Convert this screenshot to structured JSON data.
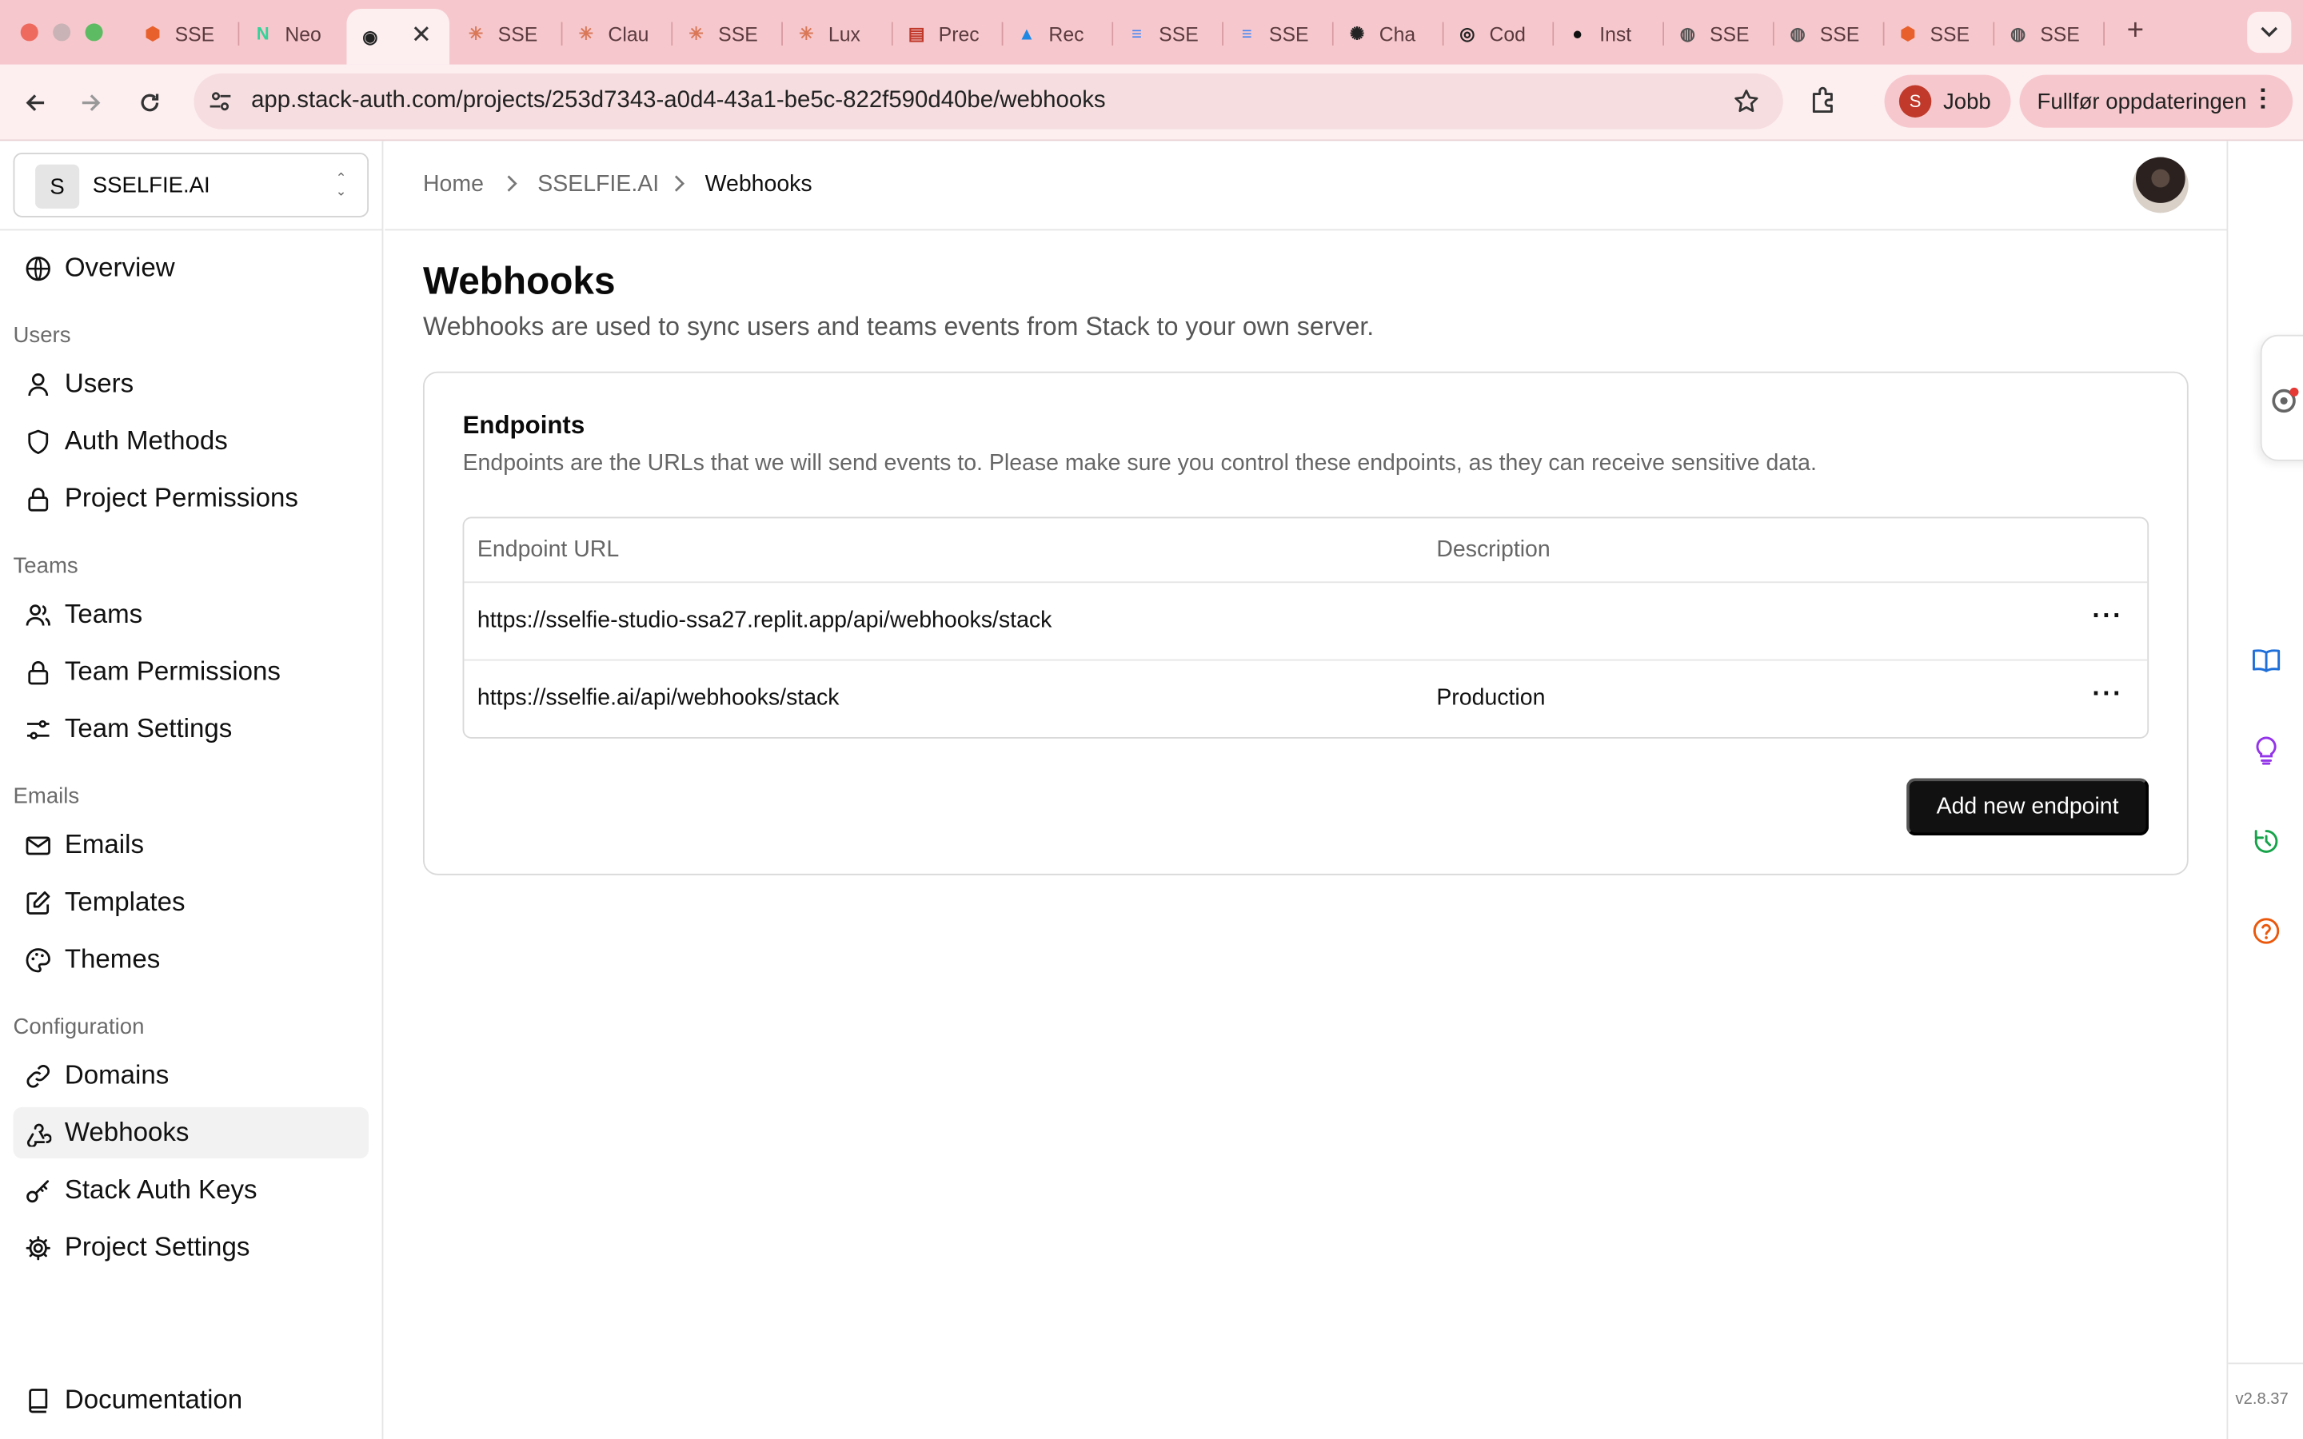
{
  "browser": {
    "tabs": [
      {
        "title": "SSE",
        "icon": "stack-icon",
        "color": "#e8612c"
      },
      {
        "title": "Neo",
        "icon": "neon-icon",
        "color": "#34d399"
      },
      {
        "title": "",
        "icon": "stack-auth-icon",
        "color": "#222222",
        "active": true
      },
      {
        "title": "SSE",
        "icon": "claude-icon",
        "color": "#d97757"
      },
      {
        "title": "Clau",
        "icon": "claude-icon",
        "color": "#d97757"
      },
      {
        "title": "SSE",
        "icon": "claude-icon",
        "color": "#d97757"
      },
      {
        "title": "Lux",
        "icon": "claude-icon",
        "color": "#d97757"
      },
      {
        "title": "Prec",
        "icon": "doc-red-icon",
        "color": "#c0392b"
      },
      {
        "title": "Rec",
        "icon": "drive-icon",
        "color": "#1e88e5"
      },
      {
        "title": "SSE",
        "icon": "docs-icon",
        "color": "#4285f4"
      },
      {
        "title": "SSE",
        "icon": "docs-icon",
        "color": "#4285f4"
      },
      {
        "title": "Cha",
        "icon": "openai-icon",
        "color": "#222222"
      },
      {
        "title": "Cod",
        "icon": "codex-icon",
        "color": "#222222"
      },
      {
        "title": "Inst",
        "icon": "github-icon",
        "color": "#111111"
      },
      {
        "title": "SSE",
        "icon": "globe-icon",
        "color": "#555555"
      },
      {
        "title": "SSE",
        "icon": "globe-icon",
        "color": "#555555"
      },
      {
        "title": "SSE",
        "icon": "stack-icon",
        "color": "#e8612c"
      },
      {
        "title": "SSE",
        "icon": "globe-icon",
        "color": "#555555"
      }
    ],
    "url": "app.stack-auth.com/projects/253d7343-a0d4-43a1-be5c-822f590d40be/webhooks",
    "profile_initial": "S",
    "profile_label": "Jobb",
    "update_label": "Fullfør oppdateringen"
  },
  "project": {
    "initial": "S",
    "name": "SSELFIE.AI"
  },
  "sidebar": {
    "overview": "Overview",
    "sections": {
      "users": "Users",
      "teams": "Teams",
      "emails": "Emails",
      "configuration": "Configuration"
    },
    "items": {
      "users": "Users",
      "auth_methods": "Auth Methods",
      "project_permissions": "Project Permissions",
      "teams": "Teams",
      "team_permissions": "Team Permissions",
      "team_settings": "Team Settings",
      "emails": "Emails",
      "templates": "Templates",
      "themes": "Themes",
      "domains": "Domains",
      "webhooks": "Webhooks",
      "stack_auth_keys": "Stack Auth Keys",
      "project_settings": "Project Settings"
    },
    "documentation": "Documentation",
    "active": "webhooks"
  },
  "breadcrumb": {
    "home": "Home",
    "project": "SSELFIE.AI",
    "current": "Webhooks"
  },
  "page": {
    "title": "Webhooks",
    "subtitle": "Webhooks are used to sync users and teams events from Stack to your own server."
  },
  "endpoints": {
    "title": "Endpoints",
    "description": "Endpoints are the URLs that we will send events to. Please make sure you control these endpoints, as they can receive sensitive data.",
    "columns": {
      "url": "Endpoint URL",
      "description": "Description"
    },
    "rows": [
      {
        "url": "https://sselfie-studio-ssa27.replit.app/api/webhooks/stack",
        "description": ""
      },
      {
        "url": "https://sselfie.ai/api/webhooks/stack",
        "description": "Production"
      }
    ],
    "add_button": "Add new endpoint"
  },
  "version": "v2.8.37"
}
